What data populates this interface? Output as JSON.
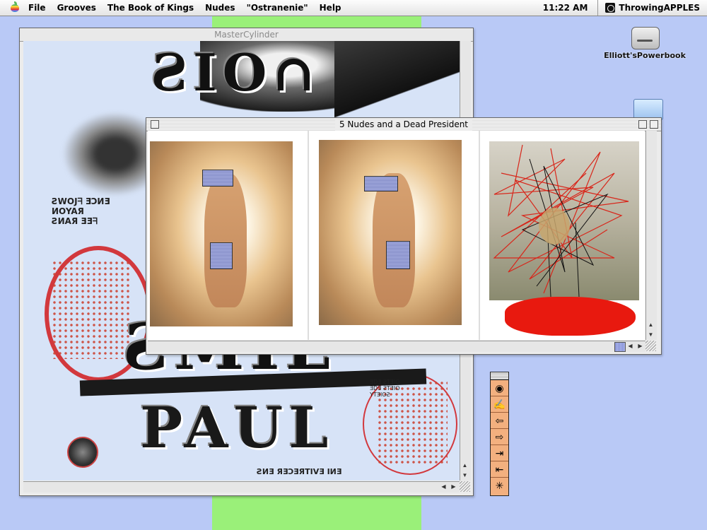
{
  "menubar": {
    "items": [
      "File",
      "Grooves",
      "The Book of Kings",
      "Nudes",
      "\"Ostranenie\"",
      "Help"
    ],
    "clock": "11:22 AM",
    "app_name": "ThrowingAPPLES"
  },
  "desktop": {
    "drive_label": "Elliott'sPowerbook"
  },
  "master_window": {
    "title": "MasterCylinder"
  },
  "nudes_window": {
    "title": "5 Nudes and a Dead President"
  },
  "palette": {
    "buttons": [
      "palette-button-eye",
      "palette-button-hand",
      "palette-button-back",
      "palette-button-forward",
      "palette-button-last",
      "palette-button-first",
      "palette-button-star"
    ]
  },
  "colors": {
    "desktop": "#b9c9f6",
    "stripe": "#9af079",
    "palette": "#f3b07f",
    "blood": "#e8190f"
  }
}
